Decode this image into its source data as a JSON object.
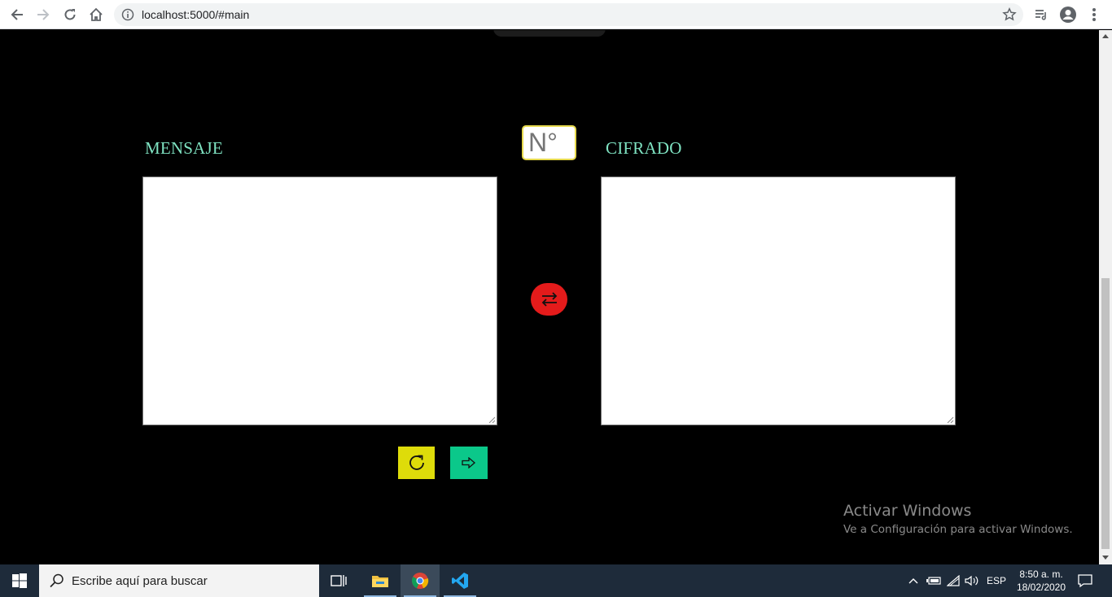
{
  "browser": {
    "url": "localhost:5000/#main"
  },
  "main": {
    "message_label": "MENSAJE",
    "cipher_label": "CIFRADO",
    "shift_placeholder": "N°",
    "message_value": "",
    "cipher_value": ""
  },
  "colors": {
    "label": "#7fe3c2",
    "swap_button": "#e41b1b",
    "reset_button": "#dedc0a",
    "go_button": "#0bc88a",
    "shift_border": "#e6d94d"
  },
  "watermark": {
    "title": "Activar Windows",
    "subtitle": "Ve a Configuración para activar Windows."
  },
  "taskbar": {
    "search_placeholder": "Escribe aquí para buscar",
    "language": "ESP",
    "time": "8:50 a. m.",
    "date": "18/02/2020"
  }
}
